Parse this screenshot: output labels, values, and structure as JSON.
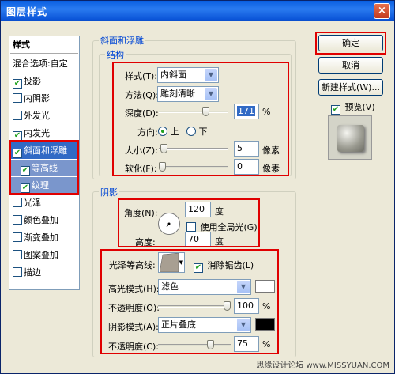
{
  "window": {
    "title": "图层样式",
    "close": "×"
  },
  "left_list": {
    "header": "样式",
    "blend_options": "混合选项:自定",
    "items": [
      {
        "label": "投影",
        "checked": true
      },
      {
        "label": "内阴影",
        "checked": false
      },
      {
        "label": "外发光",
        "checked": false
      },
      {
        "label": "内发光",
        "checked": true
      },
      {
        "label": "斜面和浮雕",
        "checked": true
      },
      {
        "label": "等高线",
        "checked": true
      },
      {
        "label": "纹理",
        "checked": true
      },
      {
        "label": "光泽",
        "checked": false
      },
      {
        "label": "颜色叠加",
        "checked": false
      },
      {
        "label": "渐变叠加",
        "checked": false
      },
      {
        "label": "图案叠加",
        "checked": false
      },
      {
        "label": "描边",
        "checked": false
      }
    ]
  },
  "bevel": {
    "group_title": "斜面和浮雕",
    "structure_title": "结构",
    "style_label": "样式(T):",
    "style_value": "内斜面",
    "technique_label": "方法(Q):",
    "technique_value": "雕刻清晰",
    "depth_label": "深度(D):",
    "depth_value": "171",
    "depth_unit": "%",
    "depth_level": 0.7,
    "direction_label": "方向:",
    "direction_up": "上",
    "direction_down": "下",
    "size_label": "大小(Z):",
    "size_value": "5",
    "size_unit": "像素",
    "size_level": 0.02,
    "soften_label": "软化(F):",
    "soften_value": "0",
    "soften_unit": "像素",
    "soften_level": 0.0
  },
  "shading": {
    "group_title": "阴影",
    "angle_label": "角度(N):",
    "angle_value": "120",
    "angle_unit": "度",
    "global_light_label": "使用全局光(G)",
    "global_light_checked": false,
    "altitude_label": "高度:",
    "altitude_value": "70",
    "altitude_unit": "度",
    "gloss_contour_label": "光泽等高线:",
    "anti_alias_label": "消除锯齿(L)",
    "anti_alias_checked": true,
    "highlight_mode_label": "高光模式(H):",
    "highlight_mode_value": "滤色",
    "highlight_color": "#ffffff",
    "highlight_opacity_label": "不透明度(O):",
    "highlight_opacity_value": "100",
    "highlight_opacity_unit": "%",
    "highlight_opacity_level": 1.0,
    "shadow_mode_label": "阴影模式(A):",
    "shadow_mode_value": "正片叠底",
    "shadow_color": "#000000",
    "shadow_opacity_label": "不透明度(C):",
    "shadow_opacity_value": "75",
    "shadow_opacity_unit": "%",
    "shadow_opacity_level": 0.75
  },
  "buttons": {
    "ok": "确定",
    "cancel": "取消",
    "new_style": "新建样式(W)...",
    "preview_label": "预览(V)",
    "preview_checked": true
  },
  "watermark": "思缘设计论坛  www.MISSYUAN.COM",
  "colors": {
    "accent_red": "#e00000",
    "selection": "#316ac5",
    "group_title": "#0046d5"
  }
}
